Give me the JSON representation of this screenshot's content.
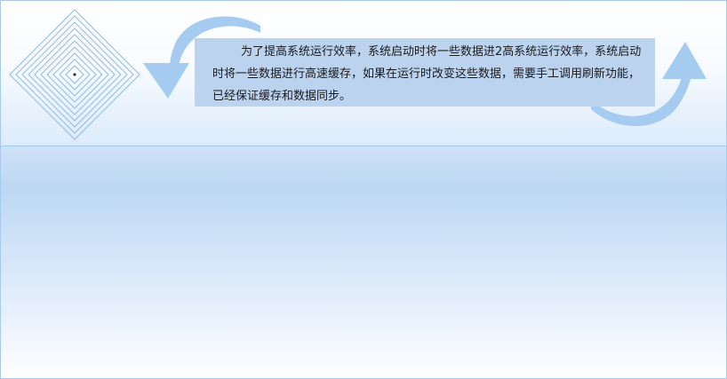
{
  "message": {
    "text": "为了提高系统运行效率，系统启动时将一些数据进2高系统运行效率，系统启动时将一些数据进行高速缓存，如果在运行时改变这些数据，需要手工调用刷新功能，已经保证缓存和数据同步。"
  },
  "icons": {
    "diamond": "concentric-diamond-icon",
    "left_arrow": "curved-arrow-down-icon",
    "right_arrow": "curved-arrow-up-icon"
  },
  "colors": {
    "border": "#a9c9ec",
    "box_fill": "#bcd3f0",
    "arrow": "#9cc6ef",
    "diamond_line": "#8fb9e6"
  }
}
